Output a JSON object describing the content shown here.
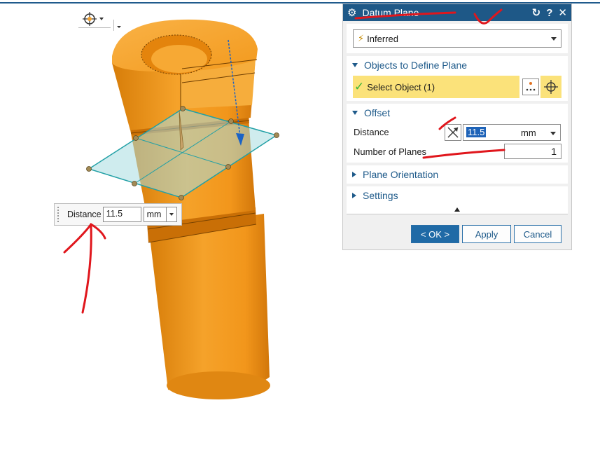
{
  "toolbar": {
    "snap_icon": "snap-point-icon"
  },
  "viewport": {
    "floating_widget": {
      "label": "Distance",
      "value": "11.5",
      "unit": "mm"
    }
  },
  "dialog": {
    "title": "Datum Plane",
    "title_icons": [
      "gear-icon",
      "reset-icon",
      "help-icon",
      "close-icon"
    ],
    "type_selector": {
      "value": "Inferred",
      "icon": "lightning-icon"
    },
    "objects_section": {
      "title": "Objects to Define Plane",
      "select_object_label": "Select Object (1)"
    },
    "offset_section": {
      "title": "Offset",
      "distance_label": "Distance",
      "distance_value": "11.5",
      "distance_unit": "mm",
      "planes_label": "Number of Planes",
      "planes_value": "1"
    },
    "plane_orientation": {
      "title": "Plane Orientation"
    },
    "settings": {
      "title": "Settings"
    },
    "buttons": {
      "ok": "< OK >",
      "apply": "Apply",
      "cancel": "Cancel"
    }
  },
  "colors": {
    "title_bar": "#1e5887",
    "model": "#f29b1e",
    "highlight": "#fbe27a",
    "annotation": "#e0161c",
    "plane": "#a8dde0"
  }
}
